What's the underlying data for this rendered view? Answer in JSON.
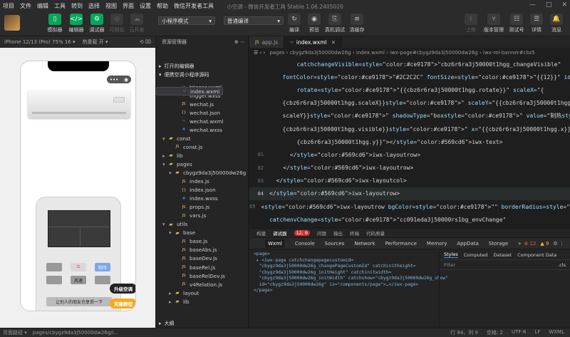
{
  "menu": [
    "项目",
    "文件",
    "编辑",
    "工具",
    "转到",
    "选择",
    "视图",
    "界面",
    "设置",
    "帮助",
    "微信开发者工具"
  ],
  "window_title": "小空调 - 微信开发者工具 Stable 1.06.2405020",
  "window_controls": [
    "—",
    "□",
    "✕"
  ],
  "toolbar": {
    "left": [
      {
        "label": "模拟器",
        "icon": "phone-icon",
        "active": true
      },
      {
        "label": "编辑器",
        "icon": "code-icon",
        "active": true
      },
      {
        "label": "调试器",
        "icon": "debug-icon",
        "active": true
      },
      {
        "label": "可视化",
        "icon": "eye-icon",
        "active": false
      },
      {
        "label": "云开发",
        "icon": "cloud-icon",
        "active": false
      }
    ],
    "mode_select": "小程序模式",
    "compile_select": "普通编译",
    "middle": [
      {
        "label": "编译",
        "icon": "refresh-icon"
      },
      {
        "label": "预览",
        "icon": "preview-icon"
      },
      {
        "label": "真机调试",
        "icon": "device-icon"
      },
      {
        "label": "清缓存",
        "icon": "layers-icon"
      }
    ],
    "right": [
      {
        "label": "上传",
        "icon": "upload-icon",
        "disabled": true
      },
      {
        "label": "版本管理",
        "icon": "version-icon"
      },
      {
        "label": "测试号",
        "icon": "test-icon"
      },
      {
        "label": "详情",
        "icon": "detail-icon"
      },
      {
        "label": "消息",
        "icon": "bell-icon"
      }
    ]
  },
  "device": {
    "model": "iPhone 12/13 (Pro) 75% 16 ▾",
    "hotreload": "热重载 开 ▾"
  },
  "simulator": {
    "capsule": [
      "•••",
      "◉"
    ],
    "remote_buttons": [
      {
        "label": "",
        "style": "gray"
      },
      {
        "label": "⏻",
        "style": "red"
      },
      {
        "label": "制冷",
        "style": "blue"
      },
      {
        "label": "",
        "style": "gray"
      },
      {
        "label": "风速",
        "style": "gray"
      },
      {
        "label": "",
        "style": "gray"
      }
    ],
    "wide_button": "让别人的朋友也享受一下",
    "fab_upgrade": "升级空调",
    "fab_gift": "克隆教程"
  },
  "explorer": {
    "title": "资源管理器",
    "sections": [
      "打开的编辑器",
      "便携空调小程序源码"
    ],
    "tree": [
      {
        "name": "trigger.wxml",
        "type": "wxml",
        "indent": 3
      },
      {
        "name": "trigger.wxss",
        "type": "wxss",
        "indent": 3
      },
      {
        "name": "wechat.js",
        "type": "js",
        "indent": 3
      },
      {
        "name": "wechat.json",
        "type": "json",
        "indent": 3
      },
      {
        "name": "wechat.wxml",
        "type": "wxml",
        "indent": 3
      },
      {
        "name": "wechat.wxss",
        "type": "wxss",
        "indent": 3
      },
      {
        "name": "const",
        "type": "folder",
        "indent": 1,
        "open": true
      },
      {
        "name": "const.js",
        "type": "js",
        "indent": 2
      },
      {
        "name": "lib",
        "type": "folder",
        "indent": 1,
        "open": false
      },
      {
        "name": "pages",
        "type": "folder",
        "indent": 1,
        "open": true
      },
      {
        "name": "cbygz9da3j50000dw26g",
        "type": "folder",
        "indent": 2,
        "open": true
      },
      {
        "name": "index.js",
        "type": "js",
        "indent": 3
      },
      {
        "name": "index.json",
        "type": "json",
        "indent": 3
      },
      {
        "name": "index.wxml",
        "type": "wxml",
        "indent": 3,
        "selected": true
      },
      {
        "name": "index.wxss",
        "type": "wxss",
        "indent": 3
      },
      {
        "name": "props.js",
        "type": "js",
        "indent": 3
      },
      {
        "name": "vars.js",
        "type": "js",
        "indent": 3
      },
      {
        "name": "utils",
        "type": "folder",
        "indent": 1,
        "open": true
      },
      {
        "name": "base",
        "type": "folder",
        "indent": 2,
        "open": true
      },
      {
        "name": "base.js",
        "type": "js",
        "indent": 3
      },
      {
        "name": "baseAbs.js",
        "type": "js",
        "indent": 3
      },
      {
        "name": "baseDev.js",
        "type": "js",
        "indent": 3
      },
      {
        "name": "baseRel.js",
        "type": "js",
        "indent": 3
      },
      {
        "name": "baseRelDev.js",
        "type": "js",
        "indent": 3
      },
      {
        "name": "v4Relation.js",
        "type": "js",
        "indent": 3
      },
      {
        "name": "layout",
        "type": "folder",
        "indent": 2,
        "open": false
      },
      {
        "name": "lib",
        "type": "folder",
        "indent": 2,
        "open": false
      }
    ],
    "outline": "大纲"
  },
  "editor": {
    "tabs": [
      {
        "name": "app.js",
        "active": false
      },
      {
        "name": "index.wxml",
        "active": true
      }
    ],
    "breadcrumb": "pages › cbygz9da3j50000dw26g › index.wxml › iwx-page#cbygz9da3j50000dw26g › iwx-rel-banner#cbz5",
    "lines": [
      {
        "n": "",
        "t": "        catchchangeVisible=\"cbz6r6ra3j50000t1hgg_changeVisible\""
      },
      {
        "n": "",
        "t": "        fontColor=\"#2C2C2C\" fontSize=\"{{12}}\" id=\"cbz6r6ra3j50000t1hgg\""
      },
      {
        "n": "",
        "t": "        rotate=\"{{cbz6r6ra3j50000t1hgg.rotate}}\" scaleX=\"{"
      },
      {
        "n": "",
        "t": "        {cbz6r6ra3j50000t1hgg.scaleX}}\" scaleY=\"{{cbz6r6ra3j50000t1hgg."
      },
      {
        "n": "",
        "t": "        scaleY}}\" shadowType=\"box\" value=\"制热\" visible=\"{"
      },
      {
        "n": "",
        "t": "        {cbz6r6ra3j50000t1hgg.visible}}\" x=\"{{cbz6r6ra3j50000t1hgg.x}}\" y=\"{"
      },
      {
        "n": "",
        "t": "        {cbz6r6ra3j50000t1hgg.y}}\"></iwx-text>"
      },
      {
        "n": "81",
        "t": "      </iwx-layoutrow>"
      },
      {
        "n": "82",
        "t": "    </iwx-layoutrow>"
      },
      {
        "n": "83",
        "t": "  </iwx-layoutcol>"
      },
      {
        "n": "84",
        "t": "</iwx-layoutrow>",
        "current": true
      },
      {
        "n": "85",
        "t": "<iwx-layoutrow bgColor=\"\" borderRadius=\"4px\""
      },
      {
        "n": "",
        "t": "catchenvChange=\"cc091eda3j50000rs1bg_envChange\""
      },
      {
        "n": "",
        "t": "catchinitHeight=\"cc091eda3j50000rs1bg_initHeight\""
      }
    ]
  },
  "devtools": {
    "tabs": [
      "构建",
      "调试器",
      "12, 9",
      "问题",
      "输出",
      "终端",
      "代码质量"
    ],
    "subtabs": [
      "Wxml",
      "Console",
      "Sources",
      "Network",
      "Performance",
      "Memory",
      "AppData",
      "Storage",
      "»"
    ],
    "badges": {
      "errors": "12",
      "warnings": "9"
    },
    "wxml": "<page>\n ▸ <iwx-page catchchangepagecustomid=\n  \"cbygz9da3j50000dw26g_changePageCustomId\" catchinitheight=\n  \"cbygz9da3j50000dw26g_initHeight\" catchinitwidth=\n  \"cbygz9da3j50000dw26g_initWidth\" catchshow=\"cbygz9da3j50000dw26g_show\"\n  id=\"cbygz9da3j50000dw26g\" is=\"components/page\">…</iwx-page>\n</page>",
    "style_tabs": [
      "Styles",
      "Computed",
      "Dataset",
      "Component Data"
    ],
    "filter": "Filter",
    "cls": ".cls"
  },
  "status": {
    "path_label": "页面路径 ▾",
    "path": "pages/cbygz9da3j50000dw26g/i...",
    "right": [
      "行 84，列 9",
      "空格: 2",
      "UTF-8",
      "LF",
      "WXML"
    ]
  }
}
